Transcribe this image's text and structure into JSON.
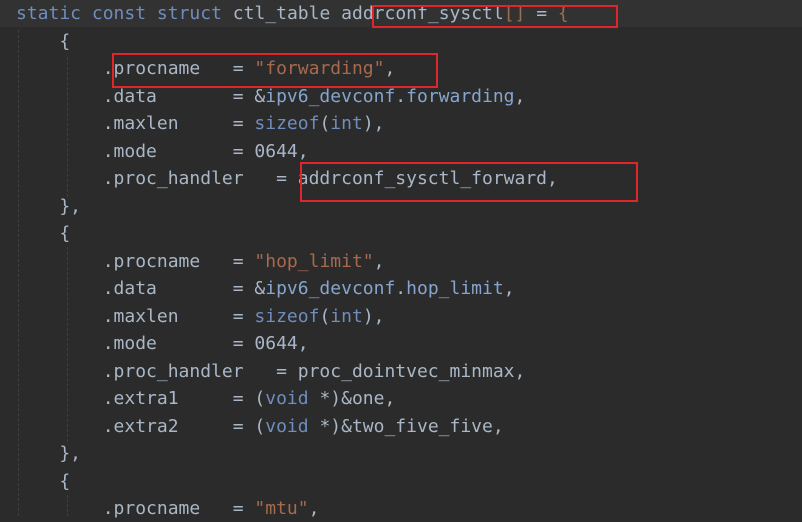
{
  "editor": {
    "theme_colors": {
      "background": "#2b2b2b",
      "plain": "#a9b7c6",
      "keyword": "#6f8dbe",
      "string": "#a86a4d",
      "field": "#86a6cf",
      "highlight_box": "#e0252b"
    },
    "lines": [
      [
        [
          "kw",
          "static"
        ],
        [
          "t",
          " "
        ],
        [
          "kw",
          "const"
        ],
        [
          "t",
          " "
        ],
        [
          "kw",
          "struct"
        ],
        [
          "t",
          " ctl_table "
        ],
        [
          "t",
          "addrconf_sysctl"
        ],
        [
          "hl",
          "[]"
        ],
        [
          "t",
          " = "
        ],
        [
          "hl",
          "{"
        ]
      ],
      [
        [
          "t",
          "    {"
        ]
      ],
      [
        [
          "t",
          "        .procname   = "
        ],
        [
          "str",
          "\"forwarding\""
        ],
        [
          "t",
          ","
        ]
      ],
      [
        [
          "t",
          "        .data       = &"
        ],
        [
          "fld",
          "ipv6_devconf"
        ],
        [
          "t",
          "."
        ],
        [
          "fld",
          "forwarding"
        ],
        [
          "t",
          ","
        ]
      ],
      [
        [
          "t",
          "        .maxlen     = "
        ],
        [
          "kw",
          "sizeof"
        ],
        [
          "t",
          "("
        ],
        [
          "kw",
          "int"
        ],
        [
          "t",
          "),"
        ]
      ],
      [
        [
          "t",
          "        .mode       = 0644,"
        ]
      ],
      [
        [
          "t",
          "        .proc_handler   = addrconf_sysctl_forward,"
        ]
      ],
      [
        [
          "t",
          "    },"
        ]
      ],
      [
        [
          "t",
          "    {"
        ]
      ],
      [
        [
          "t",
          "        .procname   = "
        ],
        [
          "str",
          "\"hop_limit\""
        ],
        [
          "t",
          ","
        ]
      ],
      [
        [
          "t",
          "        .data       = &"
        ],
        [
          "fld",
          "ipv6_devconf"
        ],
        [
          "t",
          "."
        ],
        [
          "fld",
          "hop_limit"
        ],
        [
          "t",
          ","
        ]
      ],
      [
        [
          "t",
          "        .maxlen     = "
        ],
        [
          "kw",
          "sizeof"
        ],
        [
          "t",
          "("
        ],
        [
          "kw",
          "int"
        ],
        [
          "t",
          "),"
        ]
      ],
      [
        [
          "t",
          "        .mode       = 0644,"
        ]
      ],
      [
        [
          "t",
          "        .proc_handler   = proc_dointvec_minmax,"
        ]
      ],
      [
        [
          "t",
          "        .extra1     = ("
        ],
        [
          "kw",
          "void"
        ],
        [
          "t",
          " *)&one,"
        ]
      ],
      [
        [
          "t",
          "        .extra2     = ("
        ],
        [
          "kw",
          "void"
        ],
        [
          "t",
          " *)&two_five_five,"
        ]
      ],
      [
        [
          "t",
          "    },"
        ]
      ],
      [
        [
          "t",
          "    {"
        ]
      ],
      [
        [
          "t",
          "        .procname   = "
        ],
        [
          "str",
          "\"mtu\""
        ],
        [
          "t",
          ","
        ]
      ]
    ]
  }
}
